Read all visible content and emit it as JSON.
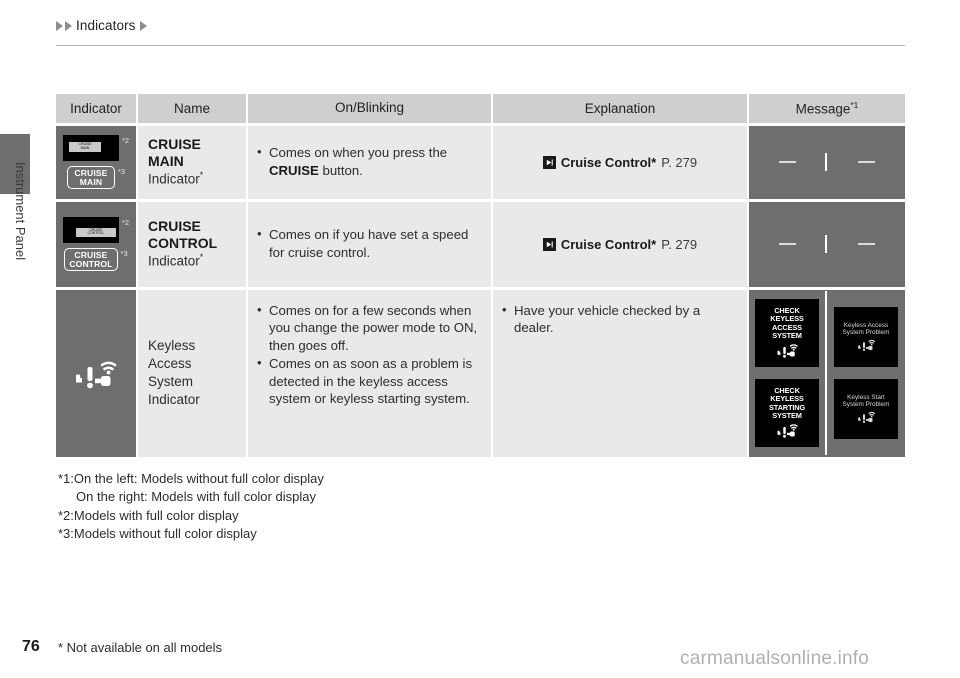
{
  "breadcrumb": {
    "label": "Indicators"
  },
  "sidebar": {
    "section_label": "Instrument Panel"
  },
  "table": {
    "headers": {
      "indicator": "Indicator",
      "name": "Name",
      "on_blinking": "On/Blinking",
      "explanation": "Explanation",
      "message": "Message",
      "message_footnote": "*1"
    },
    "rows": [
      {
        "indicator": {
          "display_panel_text": "CRUISE\nMAIN",
          "display_panel_footnote": "*2",
          "badge_line1": "CRUISE",
          "badge_line2": "MAIN",
          "badge_footnote": "*3"
        },
        "name": {
          "bold": "CRUISE MAIN",
          "sub": "Indicator",
          "asterisk": "*"
        },
        "on_blinking": [
          {
            "pre": "Comes on when you press the ",
            "strong": "CRUISE",
            "post": " button."
          }
        ],
        "explanation": {
          "xref_icon": "arrow-right-icon",
          "xref_title": "Cruise Control*",
          "xref_page": "P. 279"
        },
        "message": {
          "left": "—",
          "right": "—"
        }
      },
      {
        "indicator": {
          "display_panel_text": "CRUISE\nCONTROL",
          "display_panel_footnote": "*2",
          "badge_line1": "CRUISE",
          "badge_line2": "CONTROL",
          "badge_footnote": "*3"
        },
        "name": {
          "bold": "CRUISE\nCONTROL",
          "sub": "Indicator",
          "asterisk": "*"
        },
        "on_blinking": [
          {
            "pre": "Comes on if you have set a speed for cruise control.",
            "strong": "",
            "post": ""
          }
        ],
        "explanation": {
          "xref_icon": "arrow-right-icon",
          "xref_title": "Cruise Control*",
          "xref_page": "P. 279"
        },
        "message": {
          "left": "—",
          "right": "—"
        }
      },
      {
        "indicator": {
          "icon": "keyless-access-warning-icon"
        },
        "name": {
          "plain": "Keyless Access System Indicator"
        },
        "on_blinking": [
          {
            "pre": "Comes on for a few seconds when you change the power mode to ON, then goes off.",
            "strong": "",
            "post": ""
          },
          {
            "pre": "Comes on as soon as a problem is detected in the keyless access system or keyless starting system.",
            "strong": "",
            "post": ""
          }
        ],
        "explanation_bullets": [
          "Have your vehicle checked by a dealer."
        ],
        "message_displays": {
          "left": [
            "CHECK\nKEYLESS\nACCESS\nSYSTEM",
            "CHECK\nKEYLESS\nSTARTING\nSYSTEM"
          ],
          "right": [
            "Keyless Access\nSystem Problem",
            "Keyless Start\nSystem Problem"
          ]
        }
      }
    ]
  },
  "footnotes": {
    "line1": "*1:On the left: Models without full color display",
    "line2": "     On the right: Models with full color display",
    "line3": "*2:Models with full color display",
    "line4": "*3:Models without full color display"
  },
  "footer": {
    "page_number": "76",
    "note": "* Not available on all models",
    "watermark": "carmanualsonline.info"
  },
  "colors": {
    "indicator_cell_bg": "#6e6e6e",
    "content_cell_bg": "#e9e9e9",
    "header_bg": "#cfcfcf",
    "lcd_bg": "#000000"
  }
}
